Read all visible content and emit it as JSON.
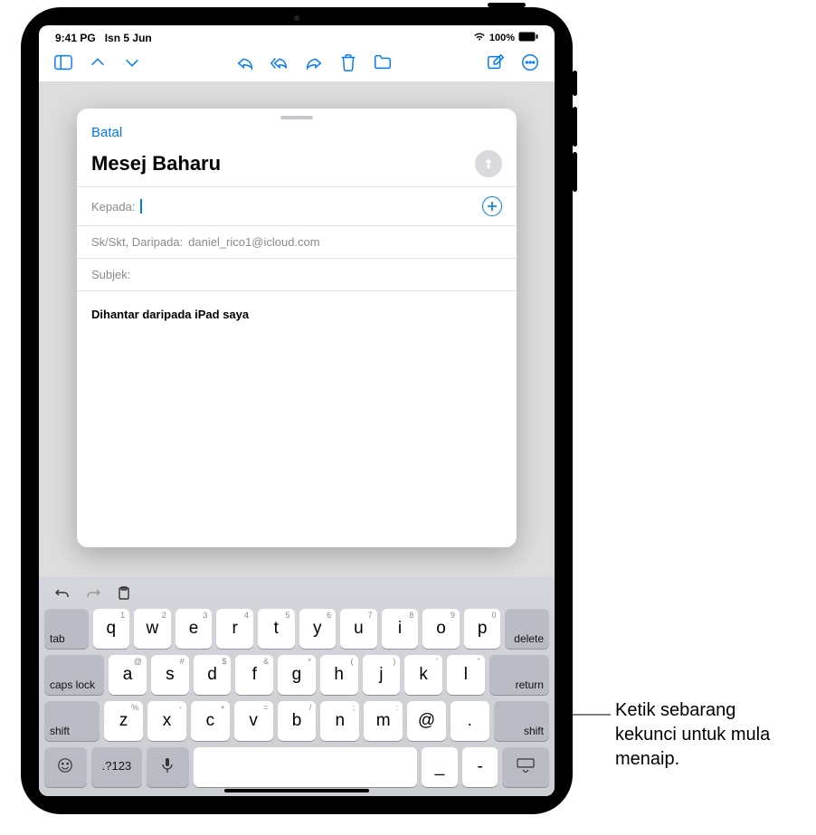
{
  "status": {
    "time": "9:41 PG",
    "date": "Isn 5 Jun",
    "battery": "100%"
  },
  "toolbar": {
    "sidebar": "sidebar",
    "up": "up",
    "down": "down",
    "reply": "reply",
    "reply_all": "reply-all",
    "forward": "forward",
    "trash": "trash",
    "folder": "folder",
    "compose": "compose",
    "more": "more"
  },
  "compose": {
    "cancel": "Batal",
    "title": "Mesej Baharu",
    "to_label": "Kepada:",
    "cc_label": "Sk/Skt, Daripada:",
    "cc_value": "daniel_rico1@icloud.com",
    "subject_label": "Subjek:",
    "signature": "Dihantar daripada iPad saya"
  },
  "keyboard": {
    "row1": [
      {
        "k": "q",
        "h": "1"
      },
      {
        "k": "w",
        "h": "2"
      },
      {
        "k": "e",
        "h": "3"
      },
      {
        "k": "r",
        "h": "4"
      },
      {
        "k": "t",
        "h": "5"
      },
      {
        "k": "y",
        "h": "6"
      },
      {
        "k": "u",
        "h": "7"
      },
      {
        "k": "i",
        "h": "8"
      },
      {
        "k": "o",
        "h": "9"
      },
      {
        "k": "p",
        "h": "0"
      }
    ],
    "row2": [
      {
        "k": "a",
        "h": "@"
      },
      {
        "k": "s",
        "h": "#"
      },
      {
        "k": "d",
        "h": "$"
      },
      {
        "k": "f",
        "h": "&"
      },
      {
        "k": "g",
        "h": "*"
      },
      {
        "k": "h",
        "h": "("
      },
      {
        "k": "j",
        "h": ")"
      },
      {
        "k": "k",
        "h": "'"
      },
      {
        "k": "l",
        "h": "\""
      }
    ],
    "row3": [
      {
        "k": "z",
        "h": "%"
      },
      {
        "k": "x",
        "h": "-"
      },
      {
        "k": "c",
        "h": "+"
      },
      {
        "k": "v",
        "h": "="
      },
      {
        "k": "b",
        "h": "/"
      },
      {
        "k": "n",
        "h": ";"
      },
      {
        "k": "m",
        "h": ":"
      },
      {
        "k": "@",
        "h": ""
      },
      {
        "k": ".",
        "h": ""
      }
    ],
    "tab": "tab",
    "delete": "delete",
    "caps": "caps lock",
    "return": "return",
    "shift": "shift",
    "numbers": ".?123",
    "dash": "_",
    "hyphen": "-"
  },
  "callout": "Ketik sebarang kekunci untuk mula menaip."
}
